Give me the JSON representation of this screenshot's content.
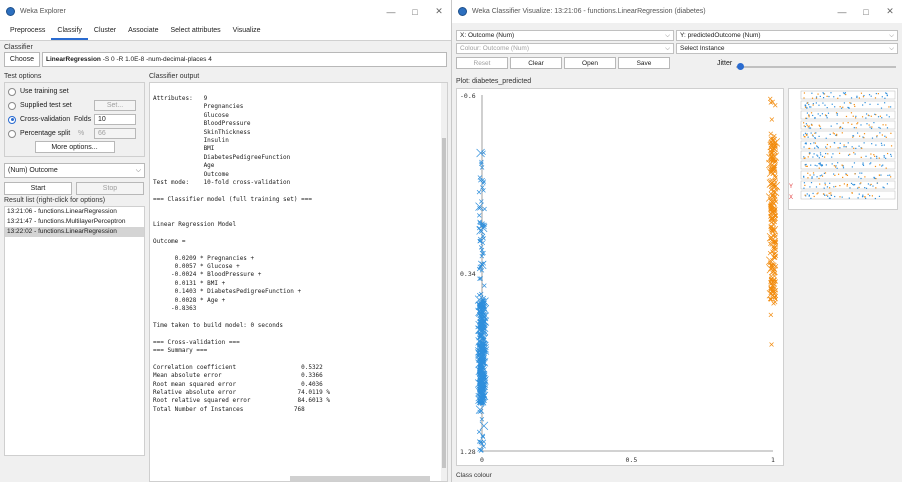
{
  "left_window": {
    "title": "Weka Explorer",
    "controls": {
      "minimize": "—",
      "maximize": "□",
      "close": "✕"
    },
    "tabs": [
      "Preprocess",
      "Classify",
      "Cluster",
      "Associate",
      "Select attributes",
      "Visualize"
    ],
    "active_tab": "Classify",
    "classifier": {
      "section_label": "Classifier",
      "choose_label": "Choose",
      "name": "LinearRegression",
      "options": " -S 0 -R 1.0E-8 -num-decimal-places 4"
    },
    "test_options": {
      "title": "Test options",
      "use_training_set": "Use training set",
      "supplied_test_set": "Supplied test set",
      "set_label": "Set...",
      "cross_validation": "Cross-validation",
      "folds_label": "Folds",
      "folds_value": "10",
      "percentage_split": "Percentage split",
      "percent_symbol": "%",
      "percent_value": "66",
      "more_options": "More options..."
    },
    "class_selector": "(Num) Outcome",
    "start_label": "Start",
    "stop_label": "Stop",
    "result_list": {
      "title": "Result list (right-click for options)",
      "items": [
        "13:21:06 - functions.LinearRegression",
        "13:21:47 - functions.MultilayerPerceptron",
        "13:22:02 - functions.LinearRegression"
      ],
      "selected_index": 2
    },
    "output": {
      "title": "Classifier output",
      "lines": [
        "Attributes:   9",
        "              Pregnancies",
        "              Glucose",
        "              BloodPressure",
        "              SkinThickness",
        "              Insulin",
        "              BMI",
        "              DiabetesPedigreeFunction",
        "              Age",
        "              Outcome",
        "Test mode:    10-fold cross-validation",
        "",
        "=== Classifier model (full training set) ===",
        "",
        "",
        "Linear Regression Model",
        "",
        "Outcome =",
        "",
        "      0.0209 * Pregnancies +",
        "      0.0057 * Glucose +",
        "     -0.0024 * BloodPressure +",
        "      0.0131 * BMI +",
        "      0.1403 * DiabetesPedigreeFunction +",
        "      0.0028 * Age +",
        "     -0.8363",
        "",
        "Time taken to build model: 0 seconds",
        "",
        "=== Cross-validation ===",
        "=== Summary ===",
        "",
        "Correlation coefficient                  0.5322",
        "Mean absolute error                      0.3366",
        "Root mean squared error                  0.4036",
        "Relative absolute error                 74.0119 %",
        "Root relative squared error             84.6013 %",
        "Total Number of Instances              768"
      ]
    }
  },
  "right_window": {
    "title": "Weka Classifier Visualize: 13:21:06 - functions.LinearRegression (diabetes)",
    "controls": {
      "minimize": "—",
      "maximize": "□",
      "close": "✕"
    },
    "x_axis": "X: Outcome (Num)",
    "y_axis": "Y: predictedOutcome (Num)",
    "colour": "Colour: Outcome (Num)",
    "select_instance": "Select Instance",
    "buttons": {
      "reset": "Reset",
      "clear": "Clear",
      "open": "Open",
      "save": "Save"
    },
    "jitter_label": "Jitter",
    "plot_title": "Plot: diabetes_predicted",
    "y_ticks": [
      "1.28",
      "0.34",
      "-0.6"
    ],
    "x_ticks": [
      "0",
      "0.5",
      "1"
    ],
    "mini_labels": {
      "y": "Y",
      "x": "X"
    },
    "class_colour_label": "Class colour",
    "colors": {
      "class_0": "#2f8fdc",
      "class_1": "#f28c0f",
      "accent": "#2a6bd0"
    }
  },
  "chart_data": {
    "type": "scatter",
    "title": "Plot: diabetes_predicted",
    "xlabel": "Outcome",
    "ylabel": "predictedOutcome",
    "xlim": [
      0,
      1
    ],
    "ylim": [
      -0.6,
      1.28
    ],
    "x_ticks": [
      0,
      0.5,
      1
    ],
    "y_ticks": [
      -0.6,
      0.34,
      1.28
    ],
    "series": [
      {
        "x": 0,
        "y_range": [
          -0.6,
          1.0
        ],
        "color": "#2f8fdc"
      },
      {
        "x": 1,
        "y_range": [
          -0.05,
          1.28
        ],
        "color": "#f28c0f"
      }
    ]
  }
}
